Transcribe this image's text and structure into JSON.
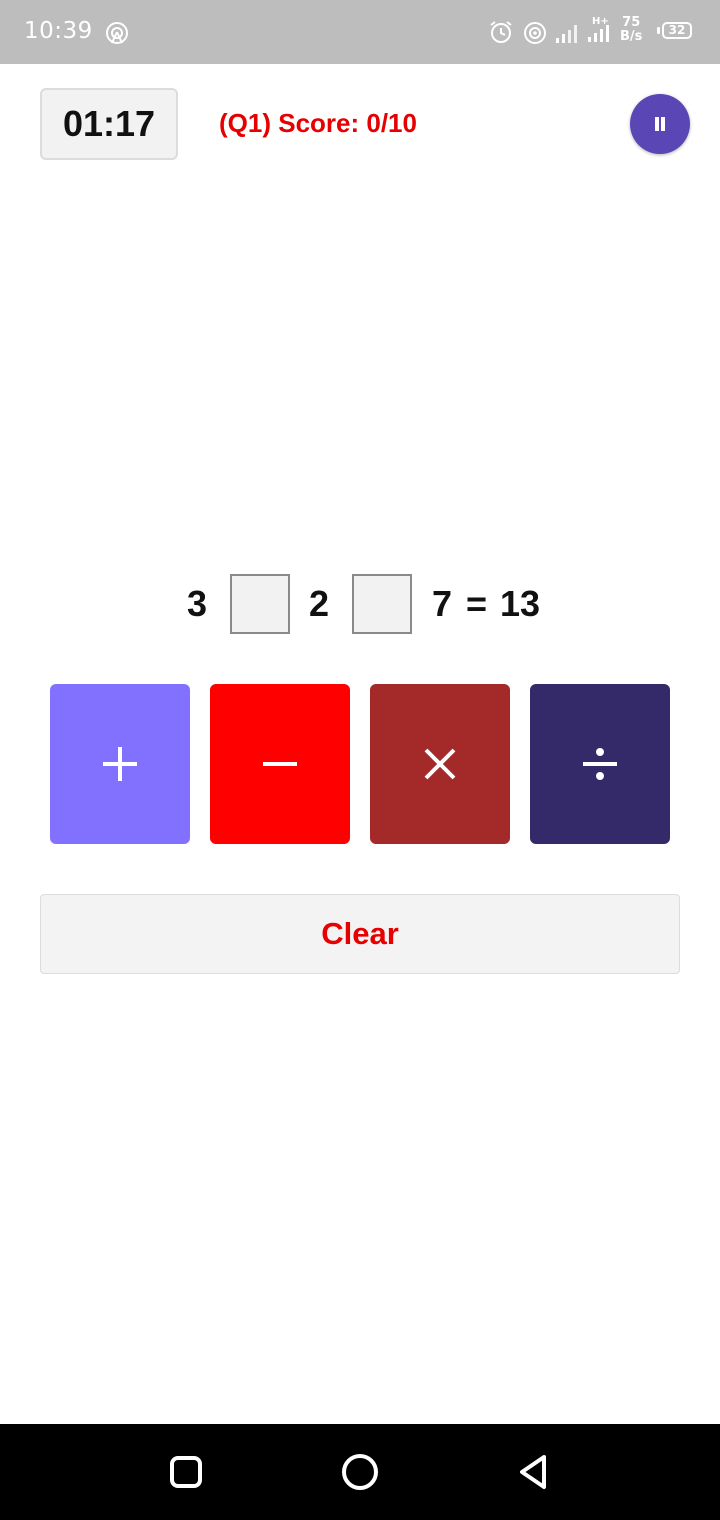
{
  "status_bar": {
    "time": "10:39",
    "net_speed_value": "75",
    "net_speed_unit": "B/s",
    "network_type": "H+",
    "battery": "32"
  },
  "game": {
    "timer": "01:17",
    "score_text": "(Q1) Score: 0/10",
    "equation": {
      "operand1": "3",
      "operand2": "2",
      "operand3": "7",
      "equals": "=",
      "result": "13"
    }
  },
  "operators": [
    {
      "name": "plus",
      "icon": "plus-icon",
      "color": "#8270ff"
    },
    {
      "name": "minus",
      "icon": "minus-icon",
      "color": "#ff0000"
    },
    {
      "name": "times",
      "icon": "times-icon",
      "color": "#a42a2a"
    },
    {
      "name": "divide",
      "icon": "divide-icon",
      "color": "#352a69"
    }
  ],
  "clear_label": "Clear",
  "colors": {
    "accent_red": "#e60000",
    "pause_button": "#5a46b5",
    "status_bar": "#bdbdbd",
    "nav_bar": "#000000"
  }
}
